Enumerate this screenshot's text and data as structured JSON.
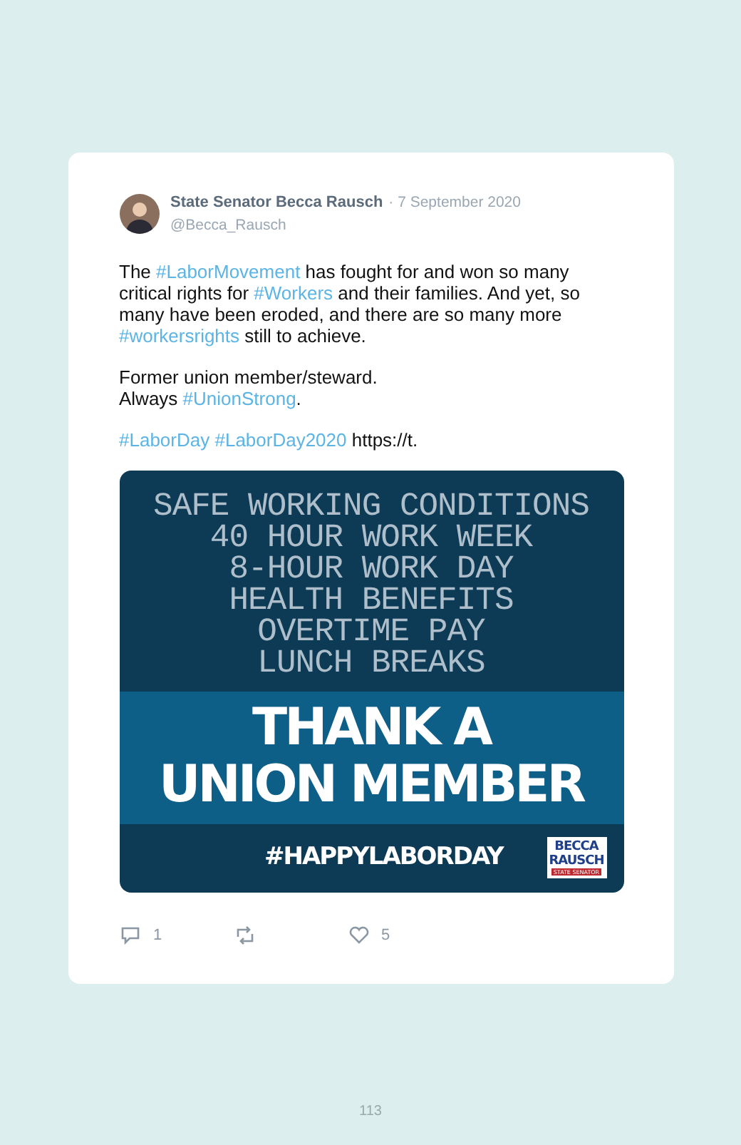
{
  "tweet": {
    "author": "State Senator Becca Rausch",
    "date": "· 7 September 2020",
    "handle": "@Becca_Rausch",
    "paragraphs": [
      [
        {
          "kind": "plain",
          "text": "The "
        },
        {
          "kind": "hashtag",
          "text": "#LaborMovement"
        },
        {
          "kind": "plain",
          "text": " has fought for and won so many critical rights for "
        },
        {
          "kind": "hashtag",
          "text": "#Workers"
        },
        {
          "kind": "plain",
          "text": " and their families. And yet, so many have been eroded, and there are so many more "
        },
        {
          "kind": "hashtag",
          "text": "#workersrights"
        },
        {
          "kind": "plain",
          "text": " still to achieve."
        }
      ],
      [
        {
          "kind": "plain",
          "text": "Former union member/steward."
        },
        {
          "kind": "break"
        },
        {
          "kind": "plain",
          "text": "Always "
        },
        {
          "kind": "hashtag",
          "text": "#UnionStrong"
        },
        {
          "kind": "plain",
          "text": "."
        }
      ],
      [
        {
          "kind": "hashtag",
          "text": "#LaborDay"
        },
        {
          "kind": "space"
        },
        {
          "kind": "hashtag",
          "text": "#LaborDay2020"
        },
        {
          "kind": "plain",
          "text": " https://t."
        }
      ]
    ],
    "graphic": {
      "list_lines": [
        "SAFE WORKING CONDITIONS",
        "40 HOUR WORK WEEK",
        "8-HOUR WORK DAY",
        "HEALTH BENEFITS",
        "OVERTIME PAY",
        "LUNCH BREAKS"
      ],
      "headline": [
        "THANK A",
        "UNION MEMBER"
      ],
      "hashtag": "#HAPPYLABORDAY",
      "logo": [
        "BECCA",
        "RAUSCH",
        "STATE SENATOR"
      ]
    },
    "actions": [
      {
        "kind": "reply",
        "count": "1"
      },
      {
        "kind": "retweet"
      },
      {
        "kind": "like",
        "count": "5"
      }
    ]
  },
  "page_number": "113"
}
